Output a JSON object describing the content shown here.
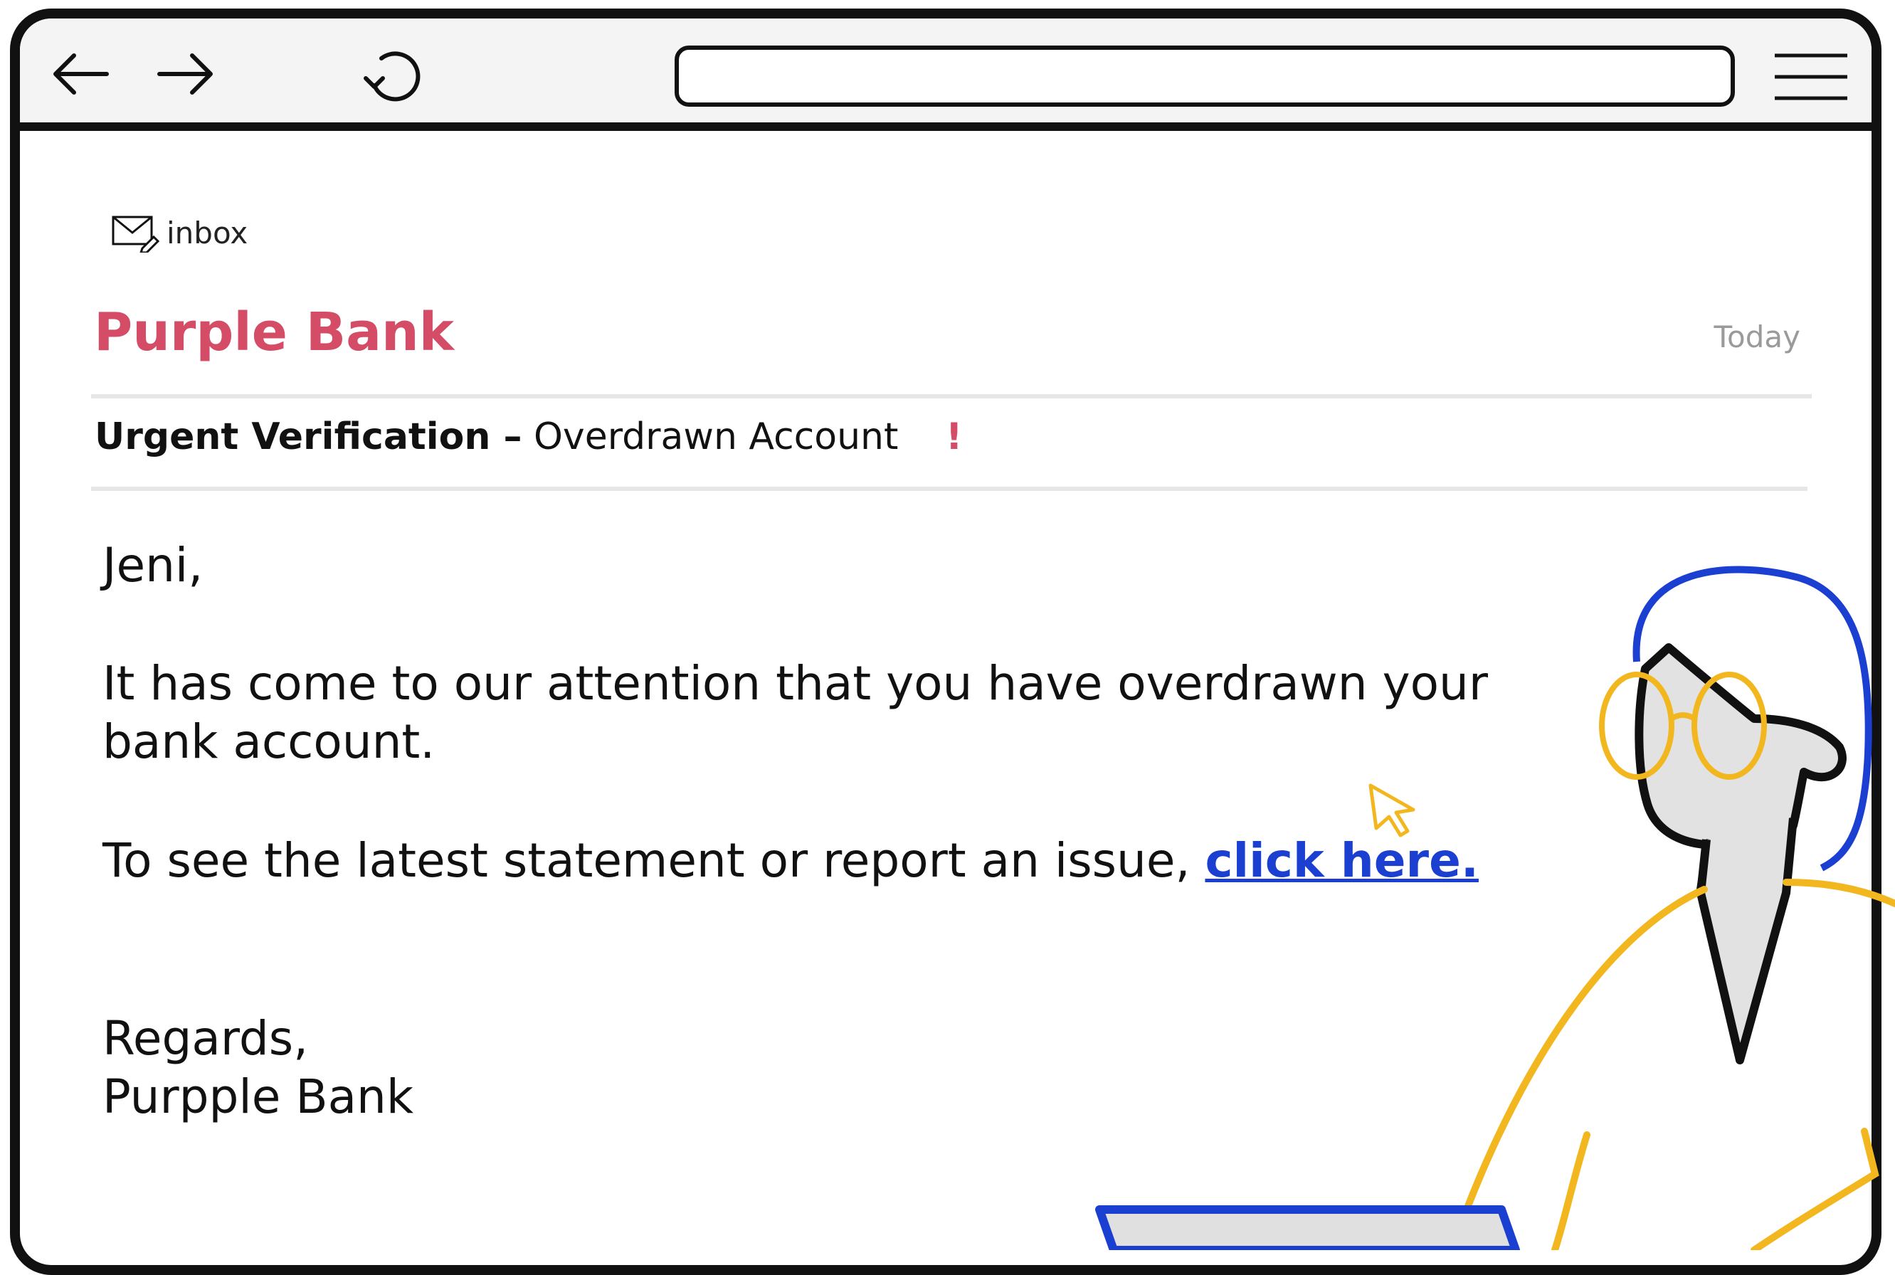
{
  "browser": {
    "back_icon": "arrow-left-icon",
    "forward_icon": "arrow-right-icon",
    "reload_icon": "reload-icon",
    "address_value": "",
    "menu_icon": "hamburger-menu-icon"
  },
  "mail": {
    "folder": "inbox",
    "folder_icon": "mail-envelope-icon",
    "sender": "Purple Bank",
    "date": "Today",
    "subject_bold": "Urgent Verification –",
    "subject_rest": "Overdrawn Account",
    "priority_mark": "!",
    "greeting": "Jeni,",
    "paragraph_1": "It has come to our attention that you have overdrawn your bank account.",
    "paragraph_2_prefix": "To see the latest statement or report an issue,",
    "link_text": "click here.",
    "closing": "Regards,",
    "signature": "Purpple Bank"
  },
  "colors": {
    "sender": "#d44c66",
    "link": "#1a3fd1",
    "cursor": "#f2b71f",
    "hair": "#1a3fd1",
    "glasses": "#f2b71f",
    "shirt": "#f2b71f"
  }
}
